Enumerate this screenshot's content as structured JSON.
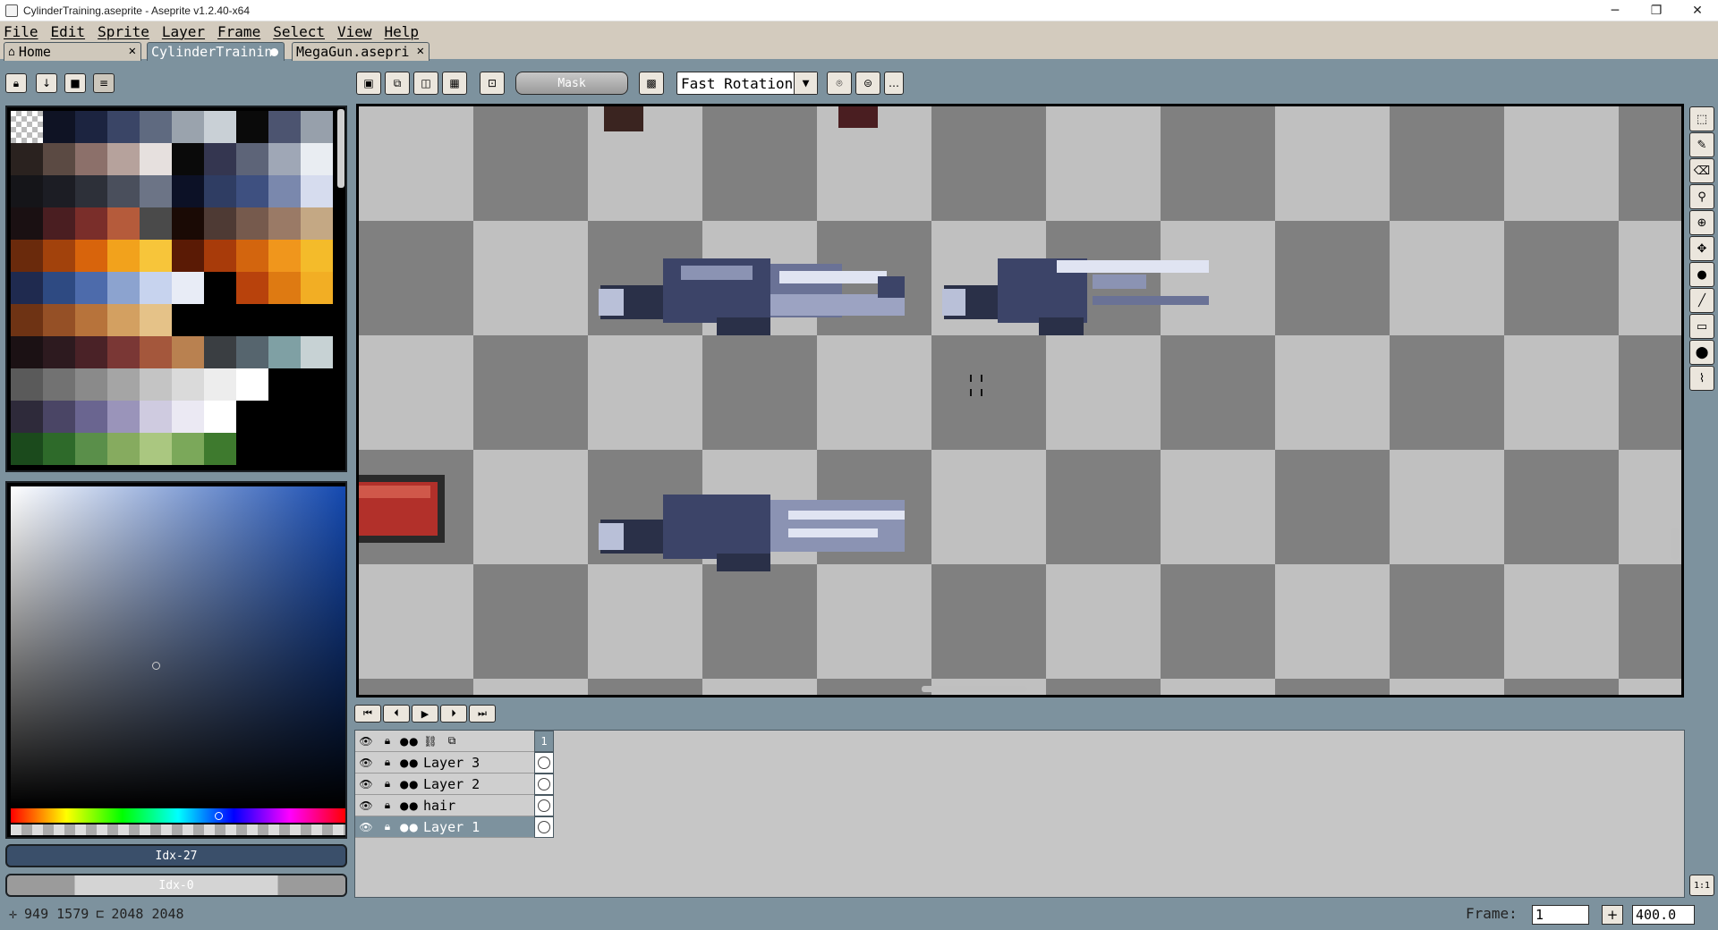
{
  "window": {
    "title": "CylinderTraining.aseprite - Aseprite v1.2.40-x64",
    "minimize": "─",
    "maximize": "❐",
    "close": "✕"
  },
  "menu": [
    "File",
    "Edit",
    "Sprite",
    "Layer",
    "Frame",
    "Select",
    "View",
    "Help"
  ],
  "tabs": [
    {
      "label": "Home",
      "close": "✕"
    },
    {
      "label": "CylinderTrainin",
      "modified": true
    },
    {
      "label": "MegaGun.asepri",
      "close": "✕"
    }
  ],
  "palette": {
    "colors": [
      "#9a9a9a",
      "#0f1324",
      "#1c2440",
      "#3a4566",
      "#5f6a80",
      "#9aa3ad",
      "#c9d0d6",
      "#0a0a0a",
      "#4c5470",
      "#97a0ab",
      "#2a221f",
      "#5b4a43",
      "#8c706a",
      "#b6a29c",
      "#e6e0de",
      "#0a0a0a",
      "#343650",
      "#5d6478",
      "#9fa7b6",
      "#e9edf2",
      "#151519",
      "#1c1d24",
      "#2d3039",
      "#4a4f5c",
      "#6c7486",
      "#0c1126",
      "#2f3d63",
      "#3e5080",
      "#7a88ad",
      "#d6dcee",
      "#1a1012",
      "#4a1e21",
      "#7a2e2a",
      "#b55b3b",
      "#4a4a4a",
      "#1a0a05",
      "#4e3a34",
      "#765a4d",
      "#9a7a66",
      "#c4a884",
      "#6a2a0c",
      "#a2420c",
      "#d8640c",
      "#f2a21c",
      "#f7c53a",
      "#5a1a05",
      "#a83b0a",
      "#d3650e",
      "#f0961c",
      "#f4bb2a",
      "#1f2a4f",
      "#2e4a82",
      "#4d6bab",
      "#8ca3cf",
      "#c7d3ee",
      "#e8ecf6",
      "#000000",
      "#b8420c",
      "#de7a12",
      "#f2ae24",
      "#6e3314",
      "#955026",
      "#b7733b",
      "#d3a061",
      "#e5c288",
      "#000000",
      "#000000",
      "#000000",
      "#000000",
      "#000000",
      "#1b1114",
      "#2d1a1f",
      "#4a2227",
      "#7a3735",
      "#a4573c",
      "#b98150",
      "#3a3e42",
      "#56656e",
      "#7fa0a4",
      "#c7d2d4",
      "#5a5a5a",
      "#727272",
      "#8a8a8a",
      "#a5a5a5",
      "#c4c4c4",
      "#dadada",
      "#ededed",
      "#ffffff",
      "#000000",
      "#000000",
      "#2e2a3a",
      "#4a4565",
      "#6a6590",
      "#9a94ba",
      "#cfcbe0",
      "#ebe9f3",
      "#ffffff",
      "#000000",
      "#000000",
      "#000000",
      "#1b4a1c",
      "#2e6a2a",
      "#5a8f4a",
      "#86ab5f",
      "#aac780",
      "#7ba85a",
      "#3e7a2e",
      "#000000",
      "#000000",
      "#000000"
    ]
  },
  "toolbar": {
    "mask_label": "Mask",
    "rotation_algorithm": "Fast Rotation"
  },
  "color": {
    "fg_index": "Idx-27",
    "bg_index": "Idx-0",
    "fg_color": "#3a4f6a",
    "accent": "#7d929e"
  },
  "status": {
    "cursor_pos": "949 1579",
    "sprite_size": "2048 2048",
    "frame_label": "Frame:",
    "frame_value": "1",
    "zoom": "400.0",
    "zoom_reset": "1:1"
  },
  "timeline": {
    "frame_number": "1",
    "layers": [
      {
        "name": "Layer 3",
        "selected": false
      },
      {
        "name": "Layer 2",
        "selected": false
      },
      {
        "name": "hair",
        "selected": false
      },
      {
        "name": "Layer 1",
        "selected": true
      }
    ]
  },
  "icons": [
    "lock-icon",
    "arrow-down-icon",
    "square-icon",
    "menu-icon",
    "eye-icon",
    "padlock-icon",
    "continuous-icon",
    "pencil-icon",
    "eraser-icon",
    "eyedropper-icon",
    "zoom-icon",
    "move-icon",
    "bucket-icon",
    "line-icon",
    "rectangle-icon",
    "blob-icon",
    "brush-icon",
    "marquee-icon",
    "play-icon"
  ]
}
